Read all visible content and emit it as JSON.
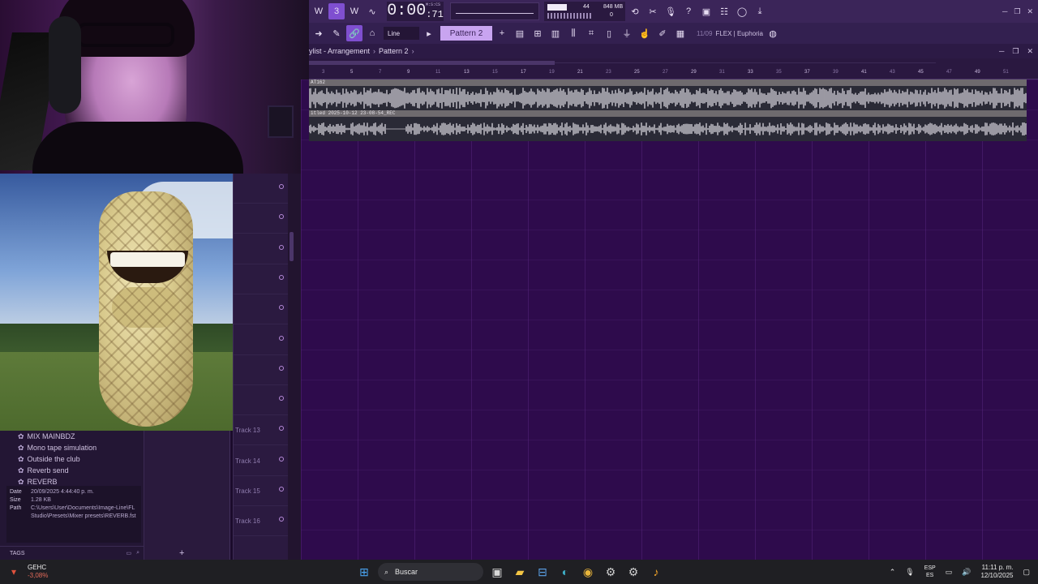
{
  "toolbar": {
    "time_main": "0:00",
    "time_ms": ":71",
    "time_caption": "M:S:CS",
    "meter_num1": "44",
    "meter_mem": "848 MB",
    "meter_num3": "0",
    "pattern_label": "Pattern 2",
    "snap_label": "Line",
    "hint_number": "11/09",
    "hint_text": "FLEX | Euphoria"
  },
  "playlist": {
    "title": "ylist - Arrangement",
    "pattern": "Pattern 2",
    "ruler": [
      "3",
      "5",
      "7",
      "9",
      "11",
      "13",
      "15",
      "17",
      "19",
      "21",
      "23",
      "25",
      "27",
      "29",
      "31",
      "33",
      "35",
      "37",
      "39",
      "41",
      "43",
      "45",
      "47",
      "49",
      "51"
    ],
    "clip1_title": "AT162",
    "clip2_title": "itled 2025-10-12 23-08-54_REC"
  },
  "tracks": [
    {
      "label": ""
    },
    {
      "label": ""
    },
    {
      "label": ""
    },
    {
      "label": ""
    },
    {
      "label": ""
    },
    {
      "label": ""
    },
    {
      "label": ""
    },
    {
      "label": ""
    },
    {
      "label": "Track 13"
    },
    {
      "label": "Track 14"
    },
    {
      "label": "Track 15"
    },
    {
      "label": "Track 16"
    }
  ],
  "browser": {
    "items": [
      "MIX MAINBDZ",
      "Mono tape simulation",
      "Outside the club",
      "Reverb send",
      "REVERB"
    ],
    "info_date_key": "Date",
    "info_date": "20/09/2025 4:44:40 p. m.",
    "info_size_key": "Size",
    "info_size": "1.28 KB",
    "info_path_key": "Path",
    "info_path": "C:\\Users\\User\\Documents\\Image-Line\\FL Studio\\Presets\\Mixer presets\\REVERB.fst",
    "tags_label": "TAGS",
    "add_label": "+"
  },
  "taskbar": {
    "weather_title": "GEHC",
    "weather_change": "-3,08%",
    "search_placeholder": "Buscar",
    "lang1": "ESP",
    "lang2": "ES",
    "time": "11:11 p. m.",
    "date": "12/10/2025"
  },
  "colors": {
    "accent": "#7f4fd0",
    "grid_bg": "#2e0b4c",
    "pattern_selector": "#c8a4f0"
  }
}
